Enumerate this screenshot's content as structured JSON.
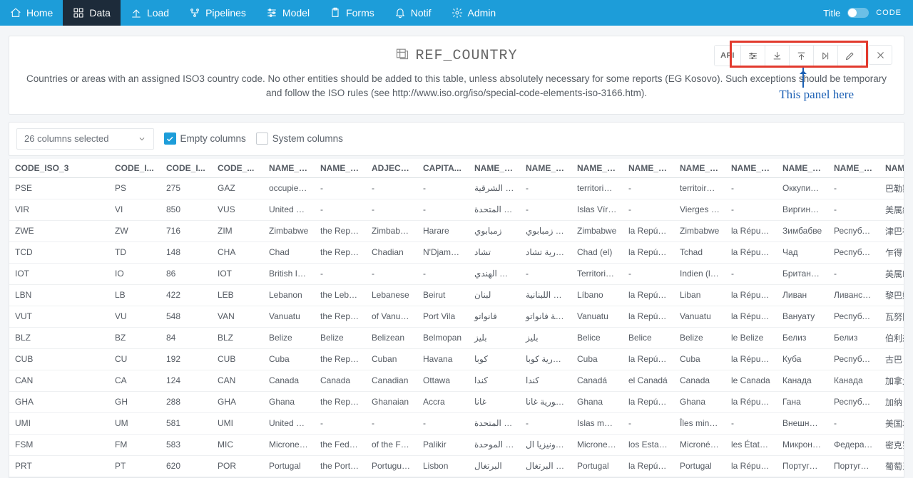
{
  "nav": {
    "items": [
      {
        "icon": "home",
        "label": "Home"
      },
      {
        "icon": "grid",
        "label": "Data",
        "active": true
      },
      {
        "icon": "upload",
        "label": "Load"
      },
      {
        "icon": "flow",
        "label": "Pipelines"
      },
      {
        "icon": "sliders",
        "label": "Model"
      },
      {
        "icon": "clipboard",
        "label": "Forms"
      },
      {
        "icon": "bell",
        "label": "Notif"
      },
      {
        "icon": "gear",
        "label": "Admin"
      }
    ],
    "right": {
      "title": "Title",
      "code": "CODE"
    }
  },
  "page": {
    "title": "REF_COUNTRY",
    "description": "Countries or areas with an assigned ISO3 country code. No other entities should be added to this table, unless absolutely necessary for some reports (EG Kosovo). Such exceptions should be temporary and follow the ISO rules (see http://www.iso.org/iso/special-code-elements-iso-3166.htm)."
  },
  "toolbar": {
    "api_label": "API"
  },
  "annotation": {
    "text": "This panel here"
  },
  "filters": {
    "columns_label": "26 columns selected",
    "empty_label": "Empty columns",
    "system_label": "System columns",
    "empty_checked": true,
    "system_checked": false
  },
  "table": {
    "headers": [
      "CODE_ISO_3",
      "CODE_I...",
      "CODE_I...",
      "CODE_...",
      "NAME_S...",
      "NAME_F...",
      "ADJECTI...",
      "CAPITA...",
      "NAME_S...",
      "NAME_F...",
      "NAME_S...",
      "NAME_F...",
      "NAME_S...",
      "NAME_F...",
      "NAME_S...",
      "NAME_F...",
      "NAME_S..."
    ],
    "rows": [
      [
        "PSE",
        "PS",
        "275",
        "GAZ",
        "occupied Pal",
        "-",
        "-",
        "-",
        "فيها القدس الشرقية",
        "-",
        "territorio pale",
        "-",
        "territoire pale",
        "-",
        "Оккупирован",
        "-",
        "巴勒斯坦被占"
      ],
      [
        "VIR",
        "VI",
        "850",
        "VUS",
        "United States",
        "-",
        "-",
        "-",
        "مة للولايات المتحدة",
        "-",
        "Islas Vírgene:",
        "-",
        "Vierges des E",
        "-",
        "Виргинские о",
        "-",
        "美属维尔京群"
      ],
      [
        "ZWE",
        "ZW",
        "716",
        "ZIM",
        "Zimbabwe",
        "the Republic",
        "Zimbabwean",
        "Harare",
        "زمبابوي",
        "جمهورية زمبابوي",
        "Zimbabwe",
        "la República",
        "Zimbabwe",
        "la République",
        "Зимбабве",
        "Республика З",
        "津巴布韦"
      ],
      [
        "TCD",
        "TD",
        "148",
        "CHA",
        "Chad",
        "the Republic",
        "Chadian",
        "N'Djamena",
        "تشاد",
        "جمهورية تشاد",
        "Chad (el)",
        "la República",
        "Tchad",
        "la République",
        "Чад",
        "Республика Ч",
        "乍得"
      ],
      [
        "IOT",
        "IO",
        "86",
        "IOT",
        "British Indian",
        "-",
        "-",
        "-",
        "ي في المحيط الهندي",
        "-",
        "Territorio Brita",
        "-",
        "Indien (le Terr",
        "-",
        "Британская т",
        "-",
        "英属印度洋领"
      ],
      [
        "LBN",
        "LB",
        "422",
        "LEB",
        "Lebanon",
        "the Lebanese",
        "Lebanese",
        "Beirut",
        "لبنان",
        "الجمهورية اللبنانية",
        "Líbano",
        "la República",
        "Liban",
        "la République",
        "Ливан",
        "Ливанская Ре",
        "黎巴嫩"
      ],
      [
        "VUT",
        "VU",
        "548",
        "VAN",
        "Vanuatu",
        "the Republic",
        "of Vanuatu, V",
        "Port Vila",
        "فانواتو",
        "جمهورية فانواتو",
        "Vanuatu",
        "la República",
        "Vanuatu",
        "la République",
        "Вануату",
        "Республика В",
        "瓦努阿图"
      ],
      [
        "BLZ",
        "BZ",
        "84",
        "BLZ",
        "Belize",
        "Belize",
        "Belizean",
        "Belmopan",
        "بليز",
        "بليز",
        "Belice",
        "Belice",
        "Belize",
        "le Belize",
        "Белиз",
        "Белиз",
        "伯利兹"
      ],
      [
        "CUB",
        "CU",
        "192",
        "CUB",
        "Cuba",
        "the Republic",
        "Cuban",
        "Havana",
        "كوبا",
        "جمهورية كوبا",
        "Cuba",
        "la República",
        "Cuba",
        "la République",
        "Куба",
        "Республика К",
        "古巴"
      ],
      [
        "CAN",
        "CA",
        "124",
        "CAN",
        "Canada",
        "Canada",
        "Canadian",
        "Ottawa",
        "كندا",
        "كندا",
        "Canadá",
        "el Canadá",
        "Canada",
        "le Canada",
        "Канада",
        "Канада",
        "加拿大"
      ],
      [
        "GHA",
        "GH",
        "288",
        "GHA",
        "Ghana",
        "the Republic",
        "Ghanaian",
        "Accra",
        "غانا",
        "جمهورية غانا",
        "Ghana",
        "la República",
        "Ghana",
        "la République",
        "Гана",
        "Республика Г",
        "加纳"
      ],
      [
        "UMI",
        "UM",
        "581",
        "UMI",
        "United States",
        "-",
        "-",
        "-",
        "مة للولايات المتحدة",
        "-",
        "Islas menores",
        "-",
        "Îles mineures",
        "-",
        "Внешние мал",
        "-",
        "美国本土外小"
      ],
      [
        "FSM",
        "FM",
        "583",
        "MIC",
        "Micronesia (F",
        "the Federate",
        "of the Federa",
        "Palikir",
        "يكرونيزيا - الموحدة)",
        "ولايات ميكرونيزيا ال",
        "Micronesia (E",
        "los Estados F",
        "Micronésie (É",
        "les États féde",
        "Микронезия",
        "Федеративнь",
        "密克罗尼西亚"
      ],
      [
        "PRT",
        "PT",
        "620",
        "POR",
        "Portugal",
        "the Portugue",
        "Portuguese",
        "Lisbon",
        "البرتغال",
        "جمهورية البرتغال",
        "Portugal",
        "la República",
        "Portugal",
        "la République",
        "Португалия",
        "Португальска",
        "葡萄牙"
      ]
    ]
  }
}
